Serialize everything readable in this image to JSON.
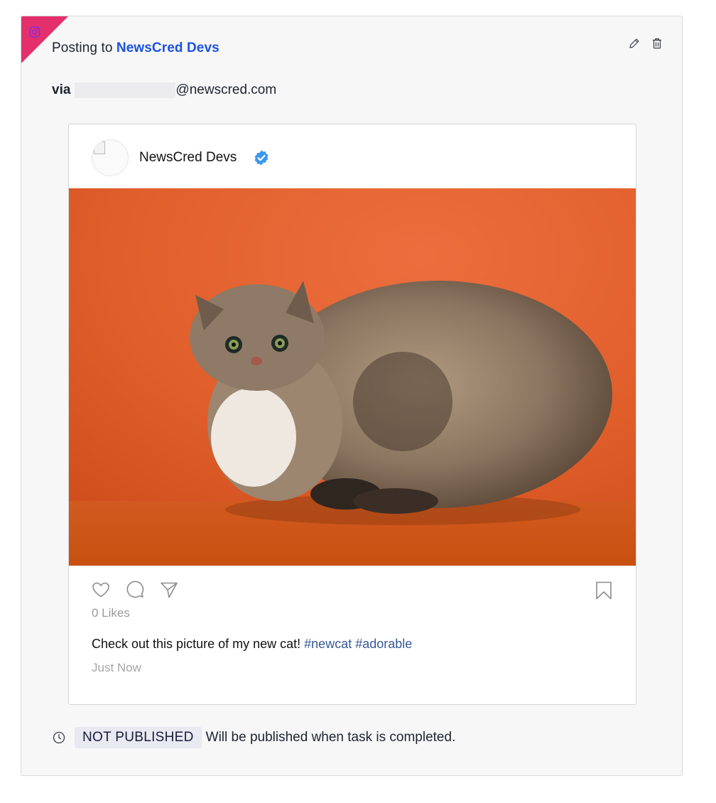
{
  "post": {
    "posting_prefix": "Posting to",
    "account_name": "NewsCred Devs",
    "via_label": "via",
    "via_email_domain": "@newscred.com",
    "network_icon": "instagram-icon",
    "network_color": "#e3306c",
    "actions": {
      "edit_icon": "pencil-icon",
      "delete_icon": "trash-icon"
    }
  },
  "preview": {
    "profile_name": "NewsCred Devs",
    "verified_icon": "verified-check-icon",
    "verified_color": "#3897f0",
    "image_alt": "Fluffy cat on orange background",
    "action_icons": [
      "heart-icon",
      "comment-icon",
      "share-icon",
      "bookmark-icon"
    ],
    "likes_text": "0 Likes",
    "caption_text": "Check out this picture of my new cat!",
    "hashtags": [
      "#newcat",
      "#adorable"
    ],
    "timestamp": "Just Now"
  },
  "status": {
    "clock_icon": "clock-icon",
    "badge": "NOT PUBLISHED",
    "message": "Will be published when task is completed."
  }
}
